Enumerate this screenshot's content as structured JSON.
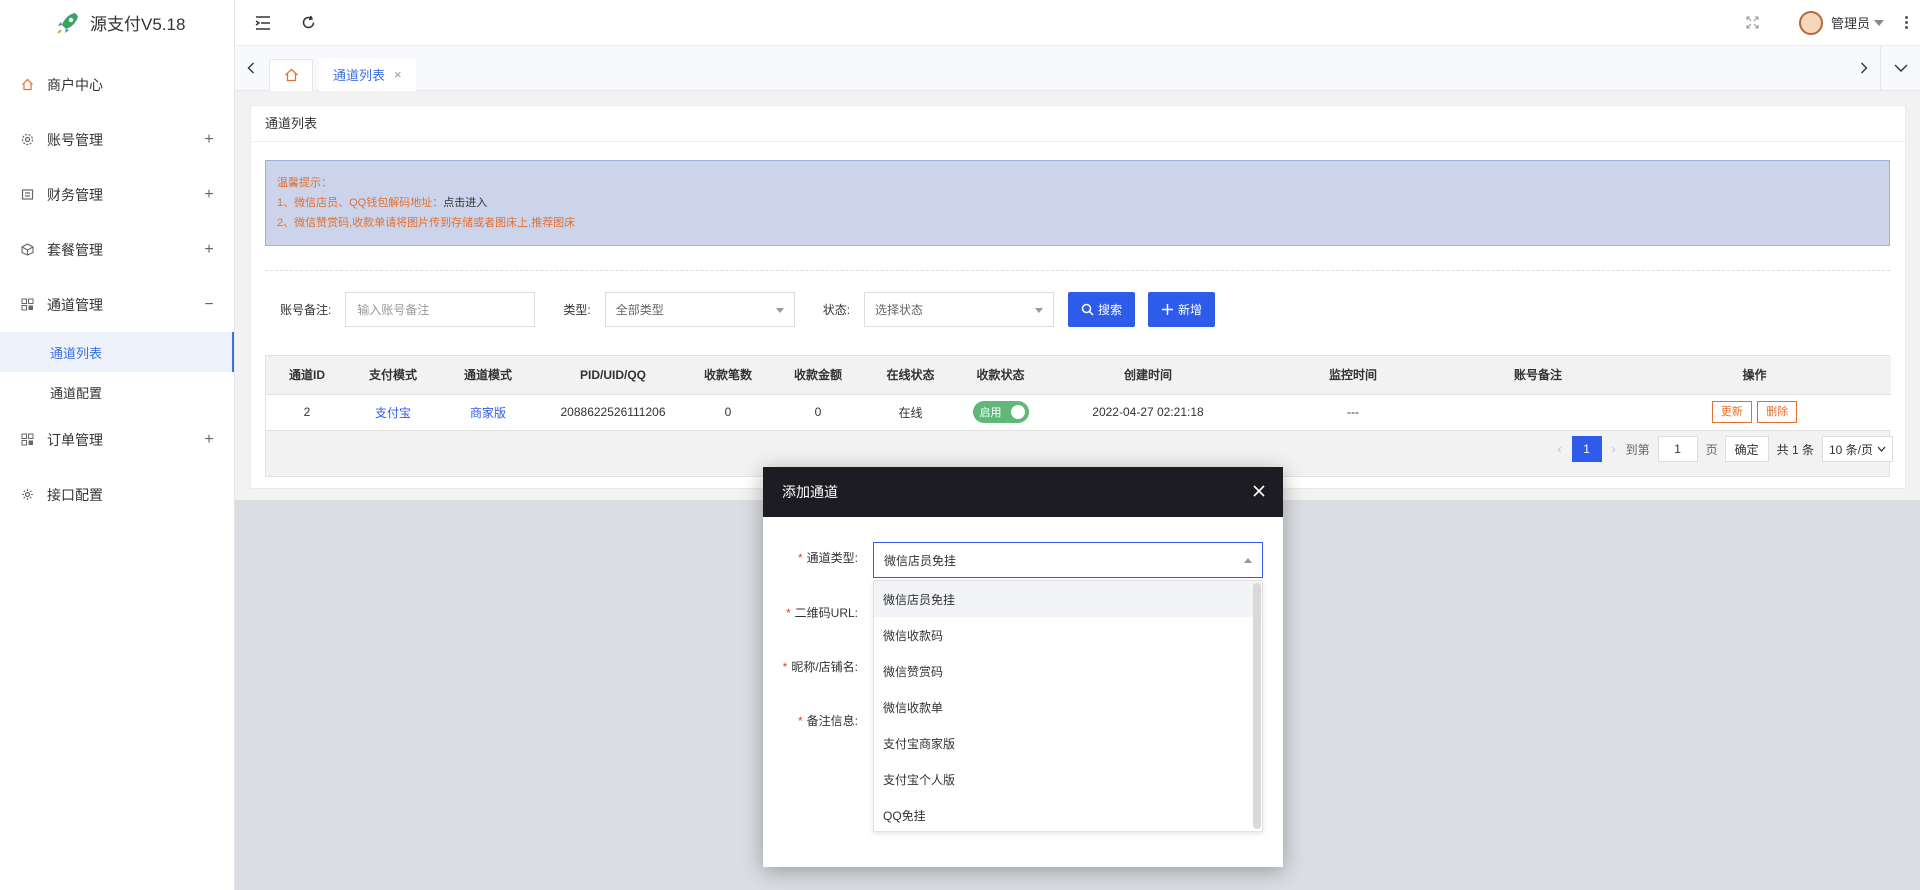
{
  "app": {
    "title": "源支付V5.18"
  },
  "sidebar": {
    "items": [
      {
        "label": "商户中心",
        "icon": "home-icon",
        "expandable": false
      },
      {
        "label": "账号管理",
        "icon": "gear-icon",
        "expandable": true,
        "toggle": "+"
      },
      {
        "label": "财务管理",
        "icon": "finance-icon",
        "expandable": true,
        "toggle": "+"
      },
      {
        "label": "套餐管理",
        "icon": "package-icon",
        "expandable": true,
        "toggle": "+"
      },
      {
        "label": "通道管理",
        "icon": "grid-icon",
        "expandable": true,
        "toggle": "−",
        "expanded": true,
        "children": [
          {
            "label": "通道列表",
            "active": true
          },
          {
            "label": "通道配置",
            "active": false
          }
        ]
      },
      {
        "label": "订单管理",
        "icon": "grid-icon",
        "expandable": true,
        "toggle": "+"
      },
      {
        "label": "接口配置",
        "icon": "api-icon",
        "expandable": false
      }
    ]
  },
  "header": {
    "user": "管理员"
  },
  "tabs": [
    {
      "label": "通道列表",
      "close": "×",
      "active": true
    }
  ],
  "page": {
    "title": "通道列表",
    "notice": {
      "heading": "温馨提示：",
      "line1_prefix": "1、微信店员、QQ钱包解码地址：",
      "line1_link": "点击进入",
      "line2": "2、微信赞赏码,收款单请将图片传到存储或者图床上,推荐图床"
    },
    "filters": {
      "remark_label": "账号备注:",
      "remark_placeholder": "输入账号备注",
      "type_label": "类型:",
      "type_value": "全部类型",
      "status_label": "状态:",
      "status_value": "选择状态",
      "search_label": "搜索",
      "add_label": "新增"
    },
    "table": {
      "columns": [
        "通道ID",
        "支付模式",
        "通道模式",
        "PID/UID/QQ",
        "收款笔数",
        "收款金额",
        "在线状态",
        "收款状态",
        "创建时间",
        "监控时间",
        "账号备注",
        "操作"
      ],
      "rows": [
        {
          "id": "2",
          "pay_mode": "支付宝",
          "channel_mode": "商家版",
          "pid": "2088622526111206",
          "count": "0",
          "amount": "0",
          "online": "在线",
          "collect_status": "启用",
          "created": "2022-04-27 02:21:18",
          "monitor": "---",
          "remark": "",
          "edit": "更新",
          "delete": "删除"
        }
      ]
    },
    "pager": {
      "current": "1",
      "goto_label": "到第",
      "goto_value": "1",
      "page_unit": "页",
      "confirm": "确定",
      "total": "共 1 条",
      "page_size": "10 条/页"
    }
  },
  "modal": {
    "title": "添加通道",
    "fields": {
      "type_label": "通道类型:",
      "qr_label": "二维码URL:",
      "nick_label": "昵称/店铺名:",
      "remark_label": "备注信息:"
    },
    "type_value": "微信店员免挂",
    "options": [
      "微信店员免挂",
      "微信收款码",
      "微信赞赏码",
      "微信收款单",
      "支付宝商家版",
      "支付宝个人版",
      "QQ免挂"
    ]
  },
  "colors": {
    "primary": "#2f5bea",
    "warning": "#e07033",
    "success": "#5fb878",
    "modal_header": "#1c1c22"
  }
}
